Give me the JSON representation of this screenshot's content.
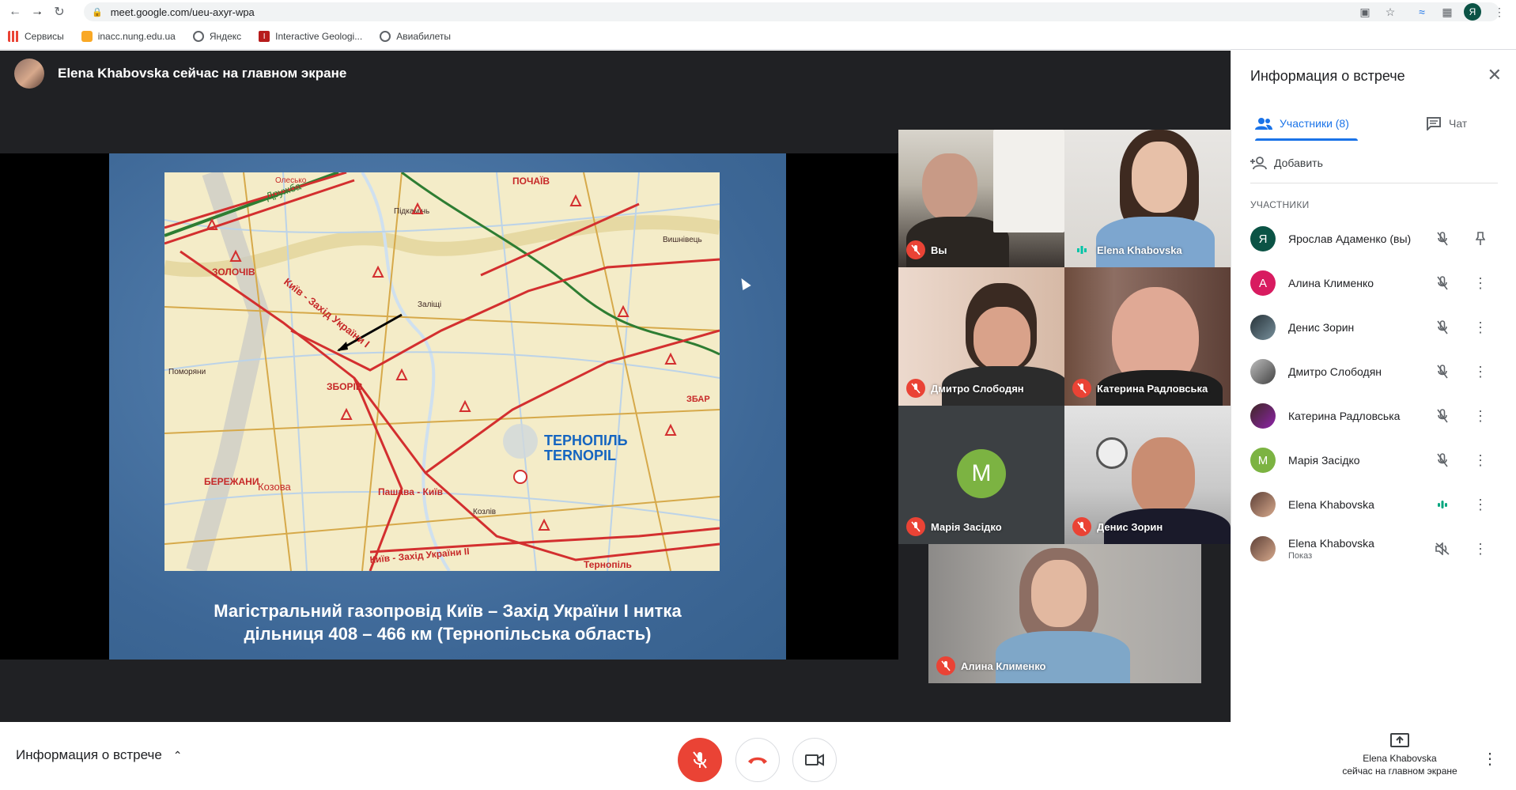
{
  "browser": {
    "url": "meet.google.com/ueu-axyr-wpa",
    "profile_initial": "Я",
    "bookmarks": [
      {
        "label": "Сервисы",
        "icon": "apps-grid-icon"
      },
      {
        "label": "inacc.nung.edu.ua",
        "icon": "crest-icon"
      },
      {
        "label": "Яндекс",
        "icon": "globe-icon"
      },
      {
        "label": "Interactive Geologi...",
        "icon": "book-icon"
      },
      {
        "label": "Авиабилеты",
        "icon": "globe-icon"
      }
    ]
  },
  "stage": {
    "presenter_text": "Elena Khabovska сейчас на главном экране",
    "slide_caption_line1": "Магістральний газопровід Київ – Захід України І нитка",
    "slide_caption_line2": "дільниця 408 – 466 км (Тернопільська область)",
    "map_labels": {
      "tern_ua": "ТЕРНОПІЛЬ",
      "tern_lat": "TERNOPIL",
      "zbоriv": "ЗБОРІВ",
      "zolochiv": "ЗОЛОЧІВ",
      "berezhany": "БЕРЕЖАНИ",
      "pochaiv": "ПОЧАЇВ",
      "kozova": "Козова",
      "druzhba": "Дружба",
      "pipeline1": "Київ - Захід України І",
      "pipeline2": "Київ - Захід України ІІ",
      "pipeline3": "Пашава - Київ",
      "zbar": "ЗБАР",
      "vyshnivets": "Вишнівець",
      "pidkamin": "Підкамінь",
      "pomoriany": "Поморяни",
      "zalishchi": "Заліщі",
      "ternopil_bottom": "Тернопіль",
      "kozliv": "Козлів",
      "olesko": "Олесько"
    },
    "tiles": [
      {
        "name": "Вы",
        "muted": true
      },
      {
        "name": "Elena Khabovska",
        "muted": false
      },
      {
        "name": "Дмитро Слободян",
        "muted": true
      },
      {
        "name": "Катерина Радловська",
        "muted": true
      },
      {
        "name": "Марія Засідко",
        "muted": true,
        "initial": "M"
      },
      {
        "name": "Денис Зорин",
        "muted": true
      },
      {
        "name": "Алина Клименко",
        "muted": true
      }
    ]
  },
  "sidepanel": {
    "title": "Информация о встрече",
    "tab_people": "Участники (8)",
    "tab_chat": "Чат",
    "add_label": "Добавить",
    "section_label": "УЧАСТНИКИ",
    "participants": [
      {
        "name": "Ярослав Адаменко (вы)",
        "initial": "Я",
        "color": "#0b5345",
        "mic": "muted",
        "action": "pin"
      },
      {
        "name": "Алина Клименко",
        "initial": "А",
        "color": "#d81b60",
        "mic": "muted",
        "action": "more"
      },
      {
        "name": "Денис Зорин",
        "initial": "",
        "color": "#37474f",
        "mic": "muted",
        "action": "more"
      },
      {
        "name": "Дмитро Слободян",
        "initial": "",
        "color": "#4e4e4e",
        "mic": "muted",
        "action": "more"
      },
      {
        "name": "Катерина Радловська",
        "initial": "",
        "color": "#3e2723",
        "mic": "muted",
        "action": "more"
      },
      {
        "name": "Марія Засідко",
        "initial": "M",
        "color": "#7cb342",
        "mic": "muted",
        "action": "more"
      },
      {
        "name": "Elena Khabovska",
        "initial": "",
        "color": "#a1887f",
        "mic": "speaking",
        "action": "more"
      },
      {
        "name": "Elena Khabovska",
        "sub": "Показ",
        "initial": "",
        "color": "#a1887f",
        "mic": "muted-screen",
        "action": "more"
      }
    ]
  },
  "bottom": {
    "meeting_info": "Информация о встрече",
    "present_line1": "Elena Khabovska",
    "present_line2": "сейчас на главном экране"
  },
  "colors": {
    "accent": "#1a73e8",
    "danger": "#ea4335",
    "speaking": "#00a67e"
  }
}
